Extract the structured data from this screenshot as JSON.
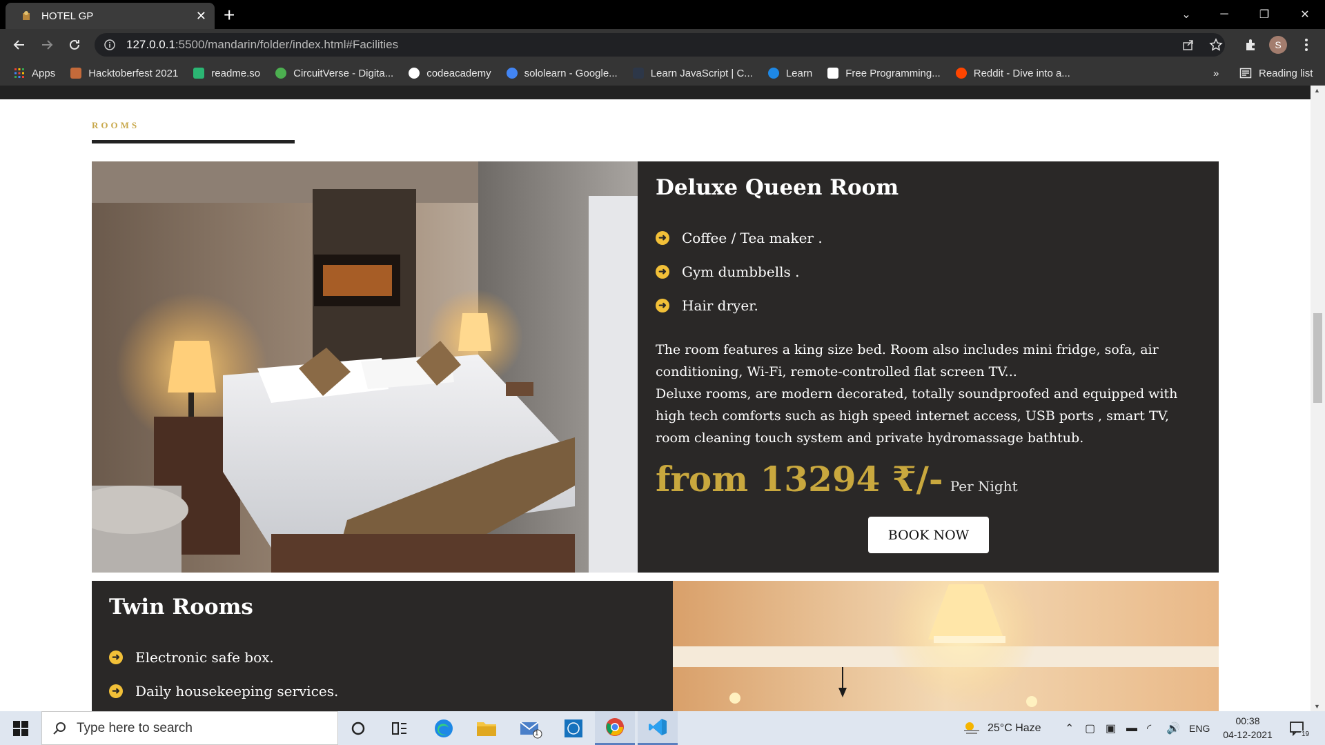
{
  "browser": {
    "tab_title": "HOTEL GP",
    "url_host": "127.0.0.1",
    "url_rest": ":5500/mandarin/folder/index.html#Facilities",
    "profile_initial": "S",
    "bookmarks": [
      {
        "label": "Apps",
        "color": "#e94235"
      },
      {
        "label": "Hacktoberfest 2021",
        "color": "#c46a3a"
      },
      {
        "label": "readme.so",
        "color": "#2bb673"
      },
      {
        "label": "CircuitVerse - Digita...",
        "color": "#4caf50"
      },
      {
        "label": "codeacademy",
        "color": "#ffffff"
      },
      {
        "label": "sololearn - Google...",
        "color": "#4285f4"
      },
      {
        "label": "Learn JavaScript | C...",
        "color": "#2d3748"
      },
      {
        "label": "Learn",
        "color": "#1e88e5"
      },
      {
        "label": "Free Programming...",
        "color": "#ffffff"
      },
      {
        "label": "Reddit - Dive into a...",
        "color": "#ff4500"
      }
    ],
    "overflow": "»",
    "reading_list": "Reading list"
  },
  "page": {
    "section_label": "ROOMS",
    "accent_color": "#c9a83e",
    "rooms": [
      {
        "title": "Deluxe Queen Room",
        "amenities": [
          "Coffee / Tea maker .",
          "Gym dumbbells .",
          "Hair dryer."
        ],
        "description_1": "The room features a king size bed. Room also includes mini fridge, sofa, air conditioning, Wi-Fi, remote-controlled flat screen TV...",
        "description_2": "Deluxe rooms, are modern decorated, totally soundproofed and equipped with high tech comforts such as high speed internet access, USB ports , smart TV, room cleaning touch system and private hydromassage bathtub.",
        "price": "from 13294 ₹/-",
        "per": "Per Night",
        "button": "BOOK NOW"
      },
      {
        "title": "Twin Rooms",
        "amenities": [
          "Electronic safe box.",
          "Daily housekeeping services."
        ]
      }
    ]
  },
  "taskbar": {
    "search_placeholder": "Type here to search",
    "weather": "25°C  Haze",
    "language": "ENG",
    "time": "00:38",
    "date": "04-12-2021",
    "mail_badge": "1",
    "notifications": "19"
  }
}
